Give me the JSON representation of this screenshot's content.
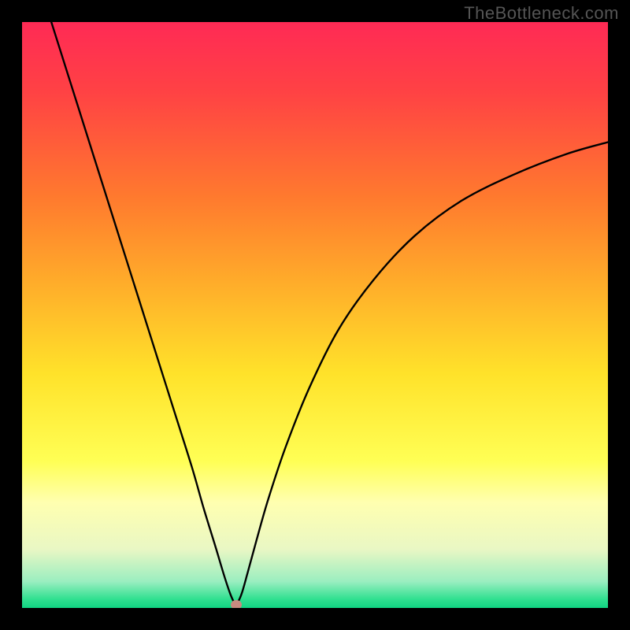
{
  "watermark": "TheBottleneck.com",
  "chart_data": {
    "type": "line",
    "title": "",
    "xlabel": "",
    "ylabel": "",
    "xlim": [
      0,
      1
    ],
    "ylim": [
      0,
      1
    ],
    "gradient_stops": [
      {
        "pos": 0.0,
        "color": "#ff2a55"
      },
      {
        "pos": 0.12,
        "color": "#ff4244"
      },
      {
        "pos": 0.3,
        "color": "#ff7a2e"
      },
      {
        "pos": 0.45,
        "color": "#ffae2a"
      },
      {
        "pos": 0.6,
        "color": "#ffe22a"
      },
      {
        "pos": 0.75,
        "color": "#ffff55"
      },
      {
        "pos": 0.82,
        "color": "#ffffb0"
      },
      {
        "pos": 0.9,
        "color": "#e9f7c4"
      },
      {
        "pos": 0.955,
        "color": "#9aeec0"
      },
      {
        "pos": 0.985,
        "color": "#30e090"
      },
      {
        "pos": 1.0,
        "color": "#10d482"
      }
    ],
    "series": [
      {
        "name": "bottleneck-curve",
        "x": [
          0.05,
          0.08,
          0.11,
          0.14,
          0.17,
          0.2,
          0.23,
          0.26,
          0.29,
          0.31,
          0.33,
          0.345,
          0.355,
          0.362,
          0.368,
          0.375,
          0.385,
          0.4,
          0.42,
          0.45,
          0.49,
          0.54,
          0.6,
          0.67,
          0.75,
          0.84,
          0.93,
          1.0
        ],
        "y": [
          1.0,
          0.905,
          0.81,
          0.715,
          0.62,
          0.525,
          0.43,
          0.335,
          0.24,
          0.17,
          0.105,
          0.055,
          0.025,
          0.01,
          0.01,
          0.025,
          0.06,
          0.115,
          0.185,
          0.275,
          0.375,
          0.475,
          0.56,
          0.635,
          0.695,
          0.74,
          0.775,
          0.795
        ]
      }
    ],
    "marker": {
      "x": 0.365,
      "y": 0.005,
      "color": "#c98a80"
    }
  }
}
